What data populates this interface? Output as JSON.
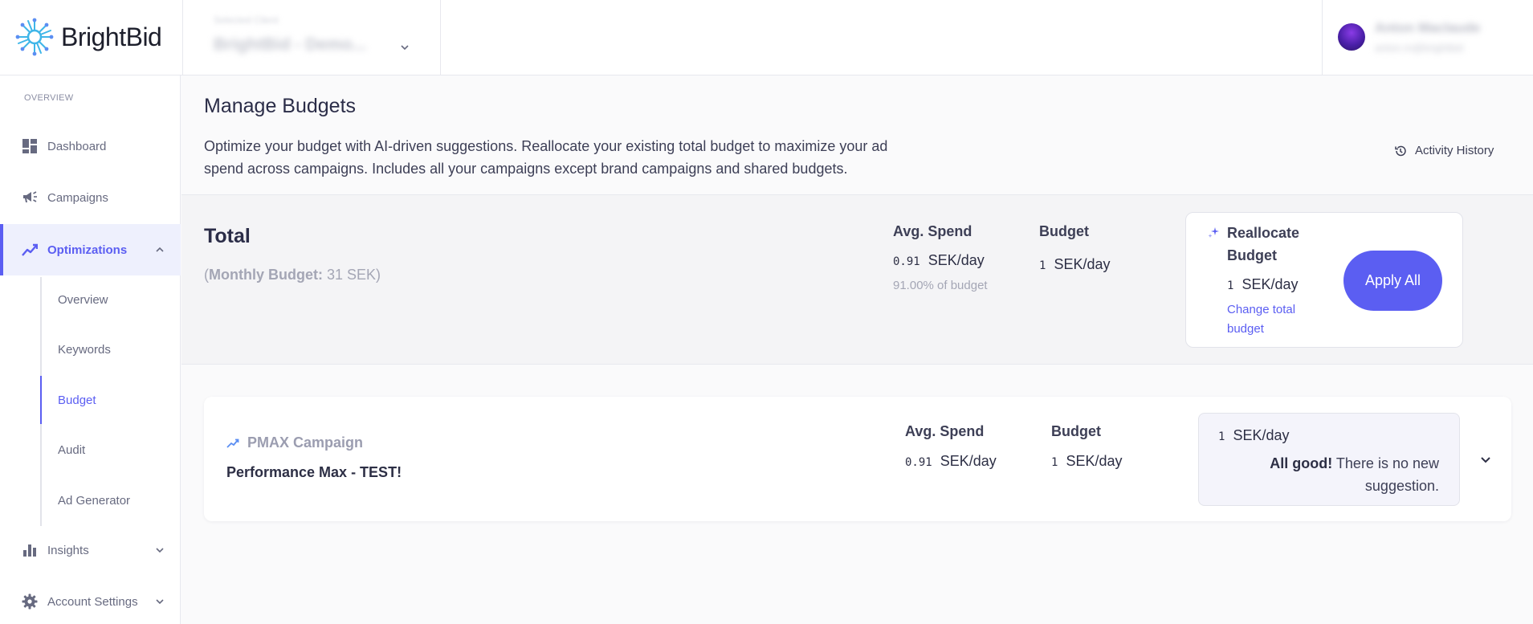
{
  "header": {
    "brand": "BrightBid",
    "account_label": "Selected Client",
    "account_value": "BrightBid - Demo...",
    "user_name": "Anton Maclaude",
    "user_email": "anton.m@brightbid"
  },
  "sidebar": {
    "section": "OVERVIEW",
    "items": [
      {
        "label": "Dashboard",
        "icon": "dashboard-icon"
      },
      {
        "label": "Campaigns",
        "icon": "megaphone-icon"
      },
      {
        "label": "Optimizations",
        "icon": "trend-icon"
      },
      {
        "label": "Insights",
        "icon": "bar-chart-icon"
      },
      {
        "label": "Account Settings",
        "icon": "gear-icon"
      }
    ],
    "sub_items": [
      {
        "label": "Overview"
      },
      {
        "label": "Keywords"
      },
      {
        "label": "Budget"
      },
      {
        "label": "Audit"
      },
      {
        "label": "Ad Generator"
      }
    ]
  },
  "page": {
    "title": "Manage Budgets",
    "description": "Optimize your budget with AI-driven suggestions. Reallocate your existing total budget to maximize your ad spend across campaigns. Includes all your campaigns except brand campaigns and shared budgets.",
    "activity_history": "Activity History"
  },
  "total": {
    "title": "Total",
    "monthly_label": "Monthly Budget:",
    "monthly_value": "31 SEK",
    "avg_spend_label": "Avg. Spend",
    "avg_spend_value": "0.91",
    "avg_spend_unit": "SEK/day",
    "pct_of_budget": "91.00% of budget",
    "budget_label": "Budget",
    "budget_value": "1",
    "budget_unit": "SEK/day",
    "reallocate_title": "Reallocate Budget",
    "reallocate_value": "1",
    "reallocate_unit": "SEK/day",
    "change_link": "Change total budget",
    "apply_button": "Apply All"
  },
  "campaign": {
    "type": "PMAX Campaign",
    "name": "Performance Max - TEST!",
    "avg_spend_label": "Avg. Spend",
    "avg_spend_value": "0.91",
    "avg_spend_unit": "SEK/day",
    "budget_label": "Budget",
    "budget_value": "1",
    "budget_unit": "SEK/day",
    "suggested_value": "1",
    "suggested_unit": "SEK/day",
    "status_bold": "All good!",
    "status_text": "There is no new suggestion."
  }
}
